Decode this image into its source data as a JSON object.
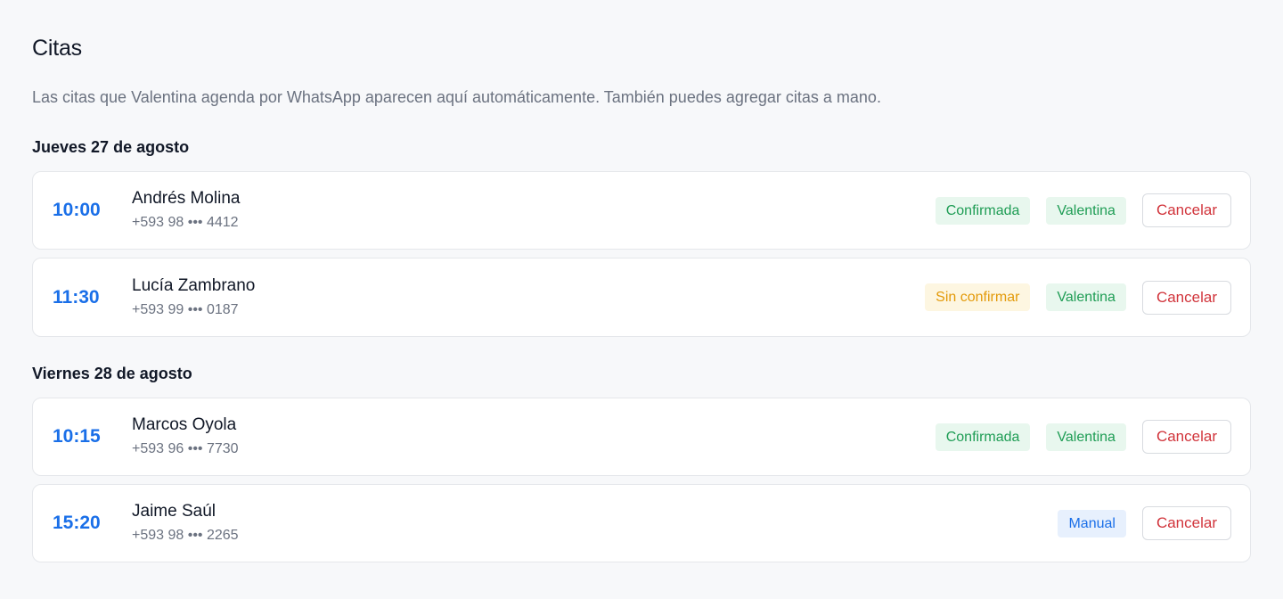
{
  "page": {
    "title": "Citas",
    "subtitle": "Las citas que Valentina agenda por WhatsApp aparecen aquí automáticamente. También puedes agregar citas a mano."
  },
  "days": [
    {
      "heading": "Jueves 27 de agosto",
      "appointments": [
        {
          "time": "10:00",
          "name": "Andrés Molina",
          "phone": "+593 98 ••• 4412",
          "status": {
            "label": "Confirmada",
            "tone": "green"
          },
          "source": {
            "label": "Valentina",
            "tone": "green"
          },
          "cancel_label": "Cancelar"
        },
        {
          "time": "11:30",
          "name": "Lucía Zambrano",
          "phone": "+593 99 ••• 0187",
          "status": {
            "label": "Sin confirmar",
            "tone": "yellow"
          },
          "source": {
            "label": "Valentina",
            "tone": "green"
          },
          "cancel_label": "Cancelar"
        }
      ]
    },
    {
      "heading": "Viernes 28 de agosto",
      "appointments": [
        {
          "time": "10:15",
          "name": "Marcos Oyola",
          "phone": "+593 96 ••• 7730",
          "status": {
            "label": "Confirmada",
            "tone": "green"
          },
          "source": {
            "label": "Valentina",
            "tone": "green"
          },
          "cancel_label": "Cancelar"
        },
        {
          "time": "15:20",
          "name": "Jaime Saúl",
          "phone": "+593 98 ••• 2265",
          "source": {
            "label": "Manual",
            "tone": "blue"
          },
          "cancel_label": "Cancelar"
        }
      ]
    }
  ],
  "colors": {
    "accent_blue": "#1a6fe8",
    "confirmed_green": "#1f9d55",
    "pending_amber": "#e39a0a",
    "cancel_red": "#d1343b",
    "background": "#f7f8fa"
  }
}
